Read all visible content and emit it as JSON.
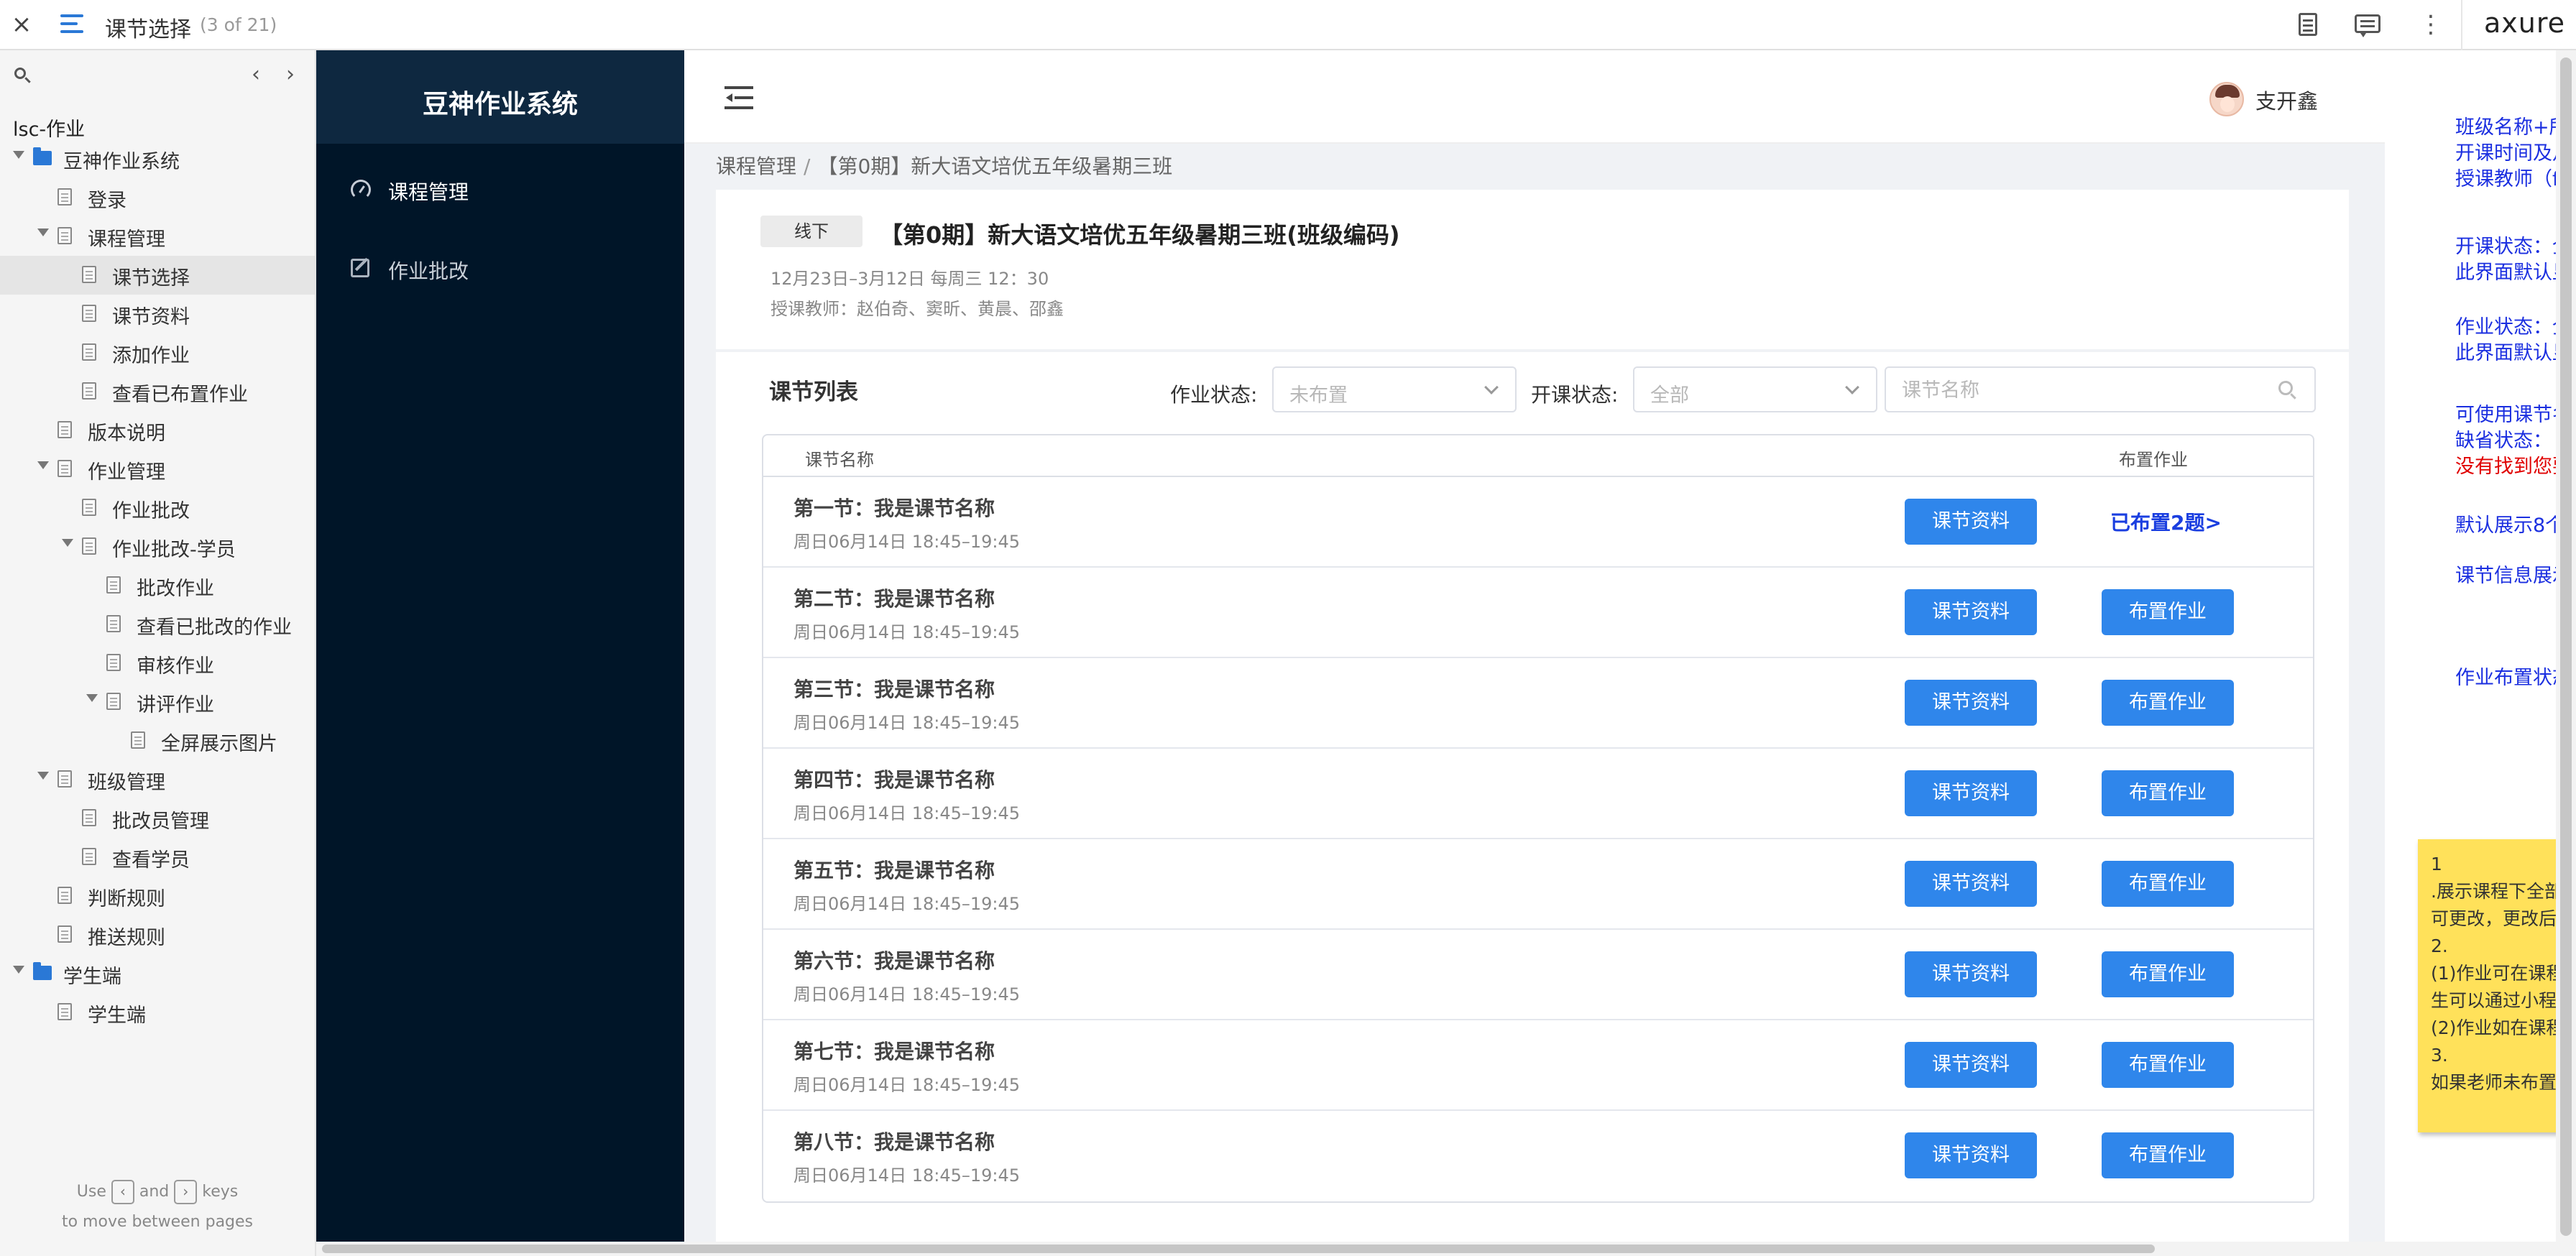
{
  "axure": {
    "close_glyph": "×",
    "page_title": "课节选择",
    "page_count": "(3 of 21)",
    "logo": "axure",
    "more_glyph": "⋮"
  },
  "sitemap": {
    "prev_glyph": "‹",
    "next_glyph": "›",
    "root": "lsc-作业",
    "items": [
      {
        "label": "豆神作业系统",
        "level": 1,
        "type": "folder",
        "expanded": true
      },
      {
        "label": "登录",
        "level": 2,
        "type": "page"
      },
      {
        "label": "课程管理",
        "level": 2,
        "type": "page",
        "expanded": true
      },
      {
        "label": "课节选择",
        "level": 3,
        "type": "page",
        "selected": true
      },
      {
        "label": "课节资料",
        "level": 3,
        "type": "page"
      },
      {
        "label": "添加作业",
        "level": 3,
        "type": "page"
      },
      {
        "label": "查看已布置作业",
        "level": 3,
        "type": "page"
      },
      {
        "label": "版本说明",
        "level": 2,
        "type": "page"
      },
      {
        "label": "作业管理",
        "level": 2,
        "type": "page",
        "expanded": true
      },
      {
        "label": "作业批改",
        "level": 3,
        "type": "page"
      },
      {
        "label": "作业批改-学员",
        "level": 3,
        "type": "page",
        "expanded": true
      },
      {
        "label": "批改作业",
        "level": 4,
        "type": "page"
      },
      {
        "label": "查看已批改的作业",
        "level": 4,
        "type": "page"
      },
      {
        "label": "审核作业",
        "level": 4,
        "type": "page"
      },
      {
        "label": "讲评作业",
        "level": 4,
        "type": "page",
        "expanded": true
      },
      {
        "label": "全屏展示图片",
        "level": 5,
        "type": "page"
      },
      {
        "label": "班级管理",
        "level": 2,
        "type": "page",
        "expanded": true
      },
      {
        "label": "批改员管理",
        "level": 3,
        "type": "page"
      },
      {
        "label": "查看学员",
        "level": 3,
        "type": "page"
      },
      {
        "label": "判断规则",
        "level": 2,
        "type": "page"
      },
      {
        "label": "推送规则",
        "level": 2,
        "type": "page"
      },
      {
        "label": "学生端",
        "level": 1,
        "type": "folder",
        "expanded": true
      },
      {
        "label": "学生端",
        "level": 2,
        "type": "page"
      }
    ],
    "footer_use": "Use",
    "footer_and": "and",
    "footer_keys": "keys",
    "footer_line2": "to move between pages",
    "key_prev": "‹",
    "key_next": "›"
  },
  "app": {
    "brand": "豆神作业系统",
    "nav": [
      {
        "label": "课程管理",
        "icon": "dashboard-icon",
        "active": true
      },
      {
        "label": "作业批改",
        "icon": "edit-icon",
        "active": false
      }
    ],
    "user_name": "支开鑫",
    "breadcrumb": {
      "root": "课程管理",
      "sep": "/",
      "current": "【第0期】新大语文培优五年级暑期三班"
    },
    "course": {
      "tag": "线下",
      "title": "【第0期】新大语文培优五年级暑期三班(班级编码)",
      "time": "12月23日–3月12日 每周三 12：30",
      "teachers": "授课教师：赵伯奇、窦昕、黄晨、邵鑫"
    },
    "list": {
      "title": "课节列表",
      "hw_status_label": "作业状态:",
      "hw_status_value": "未布置",
      "class_status_label": "开课状态:",
      "class_status_value": "全部",
      "search_placeholder": "课节名称",
      "col_name": "课节名称",
      "col_assign": "布置作业",
      "material_btn": "课节资料",
      "assign_btn": "布置作业",
      "rows": [
        {
          "name": "第一节：我是课节名称",
          "time": "周日06月14日 18:45–19:45",
          "assigned": "已布置2题>"
        },
        {
          "name": "第二节：我是课节名称",
          "time": "周日06月14日 18:45–19:45",
          "assigned": ""
        },
        {
          "name": "第三节：我是课节名称",
          "time": "周日06月14日 18:45–19:45",
          "assigned": ""
        },
        {
          "name": "第四节：我是课节名称",
          "time": "周日06月14日 18:45–19:45",
          "assigned": ""
        },
        {
          "name": "第五节：我是课节名称",
          "time": "周日06月14日 18:45–19:45",
          "assigned": ""
        },
        {
          "name": "第六节：我是课节名称",
          "time": "周日06月14日 18:45–19:45",
          "assigned": ""
        },
        {
          "name": "第七节：我是课节名称",
          "time": "周日06月14日 18:45–19:45",
          "assigned": ""
        },
        {
          "name": "第八节：我是课节名称",
          "time": "周日06月14日 18:45–19:45",
          "assigned": ""
        }
      ]
    }
  },
  "annotations": {
    "notes": [
      {
        "text": "班级名称+所",
        "red": false
      },
      {
        "text": "开课时间及月",
        "red": false
      },
      {
        "text": "授课教师（f",
        "red": false
      },
      {
        "text": "开课状态：全",
        "red": false
      },
      {
        "text": "此界面默认显",
        "red": false
      },
      {
        "text": "作业状态：全",
        "red": false
      },
      {
        "text": "此界面默认显",
        "red": false
      },
      {
        "text": "可使用课节名",
        "red": false
      },
      {
        "text": "缺省状态：",
        "red": false
      },
      {
        "text": "没有找到您要",
        "red": true
      },
      {
        "text": "默认展示8个",
        "red": false
      },
      {
        "text": "课节信息展示",
        "red": false
      },
      {
        "text": "作业布置状态",
        "red": false
      }
    ],
    "sticky_lines": [
      "1",
      ".展示课程下全部",
      "可更改，更改后",
      "2.",
      "(1)作业可在课程",
      "生可以通过小程",
      "(2)作业如在课程",
      "3.",
      "如果老师未布置"
    ]
  }
}
